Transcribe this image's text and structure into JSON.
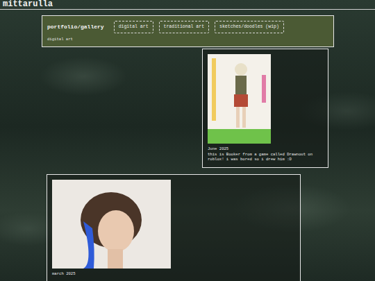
{
  "site": {
    "title": "mittarulla"
  },
  "header": {
    "title": "portfolio/gallery",
    "tabs": [
      {
        "label": "digital art"
      },
      {
        "label": "traditional art"
      },
      {
        "label": "sketches/doodles (wip)"
      }
    ],
    "section": "digital art"
  },
  "posts": [
    {
      "date": "June 2025",
      "caption": "this is Booker from a game called Drawnout on roblox! i was bored so i drew him :D"
    },
    {
      "date": "march 2025",
      "caption": ""
    }
  ]
}
